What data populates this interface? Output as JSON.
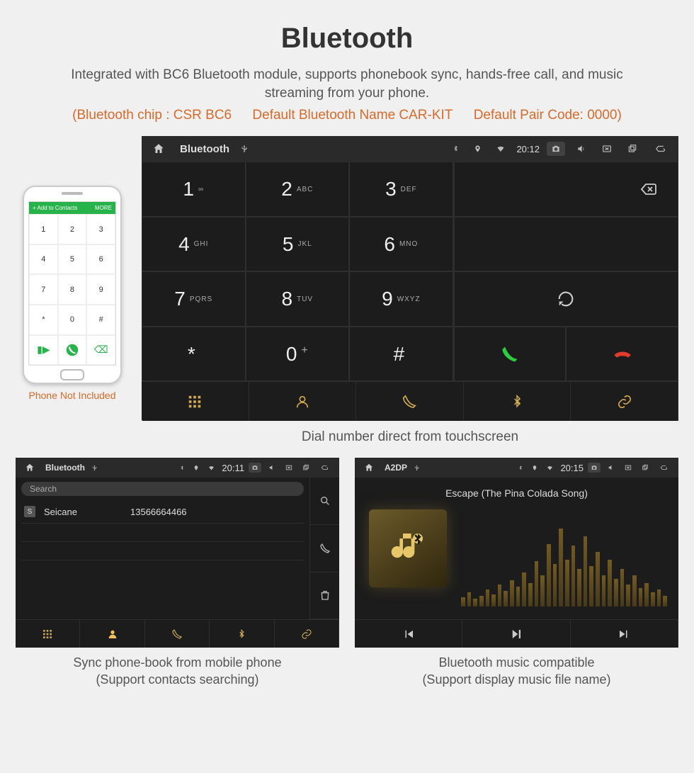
{
  "title": "Bluetooth",
  "subtitle": "Integrated with BC6 Bluetooth module, supports phonebook sync, hands-free call, and music streaming from your phone.",
  "spec": {
    "chip": "(Bluetooth chip : CSR BC6",
    "name": "Default Bluetooth Name CAR-KIT",
    "code": "Default Pair Code: 0000)"
  },
  "phone": {
    "bar_left": "+  Add to Contacts",
    "bar_right": "MORE",
    "caption": "Phone Not Included",
    "keys": [
      "1",
      "2",
      "3",
      "4",
      "5",
      "6",
      "7",
      "8",
      "9",
      "*",
      "0",
      "#"
    ]
  },
  "dialer": {
    "statusbar": {
      "app": "Bluetooth",
      "time": "20:12"
    },
    "keys": [
      {
        "d": "1",
        "l": "∞"
      },
      {
        "d": "2",
        "l": "ABC"
      },
      {
        "d": "3",
        "l": "DEF"
      },
      {
        "d": "4",
        "l": "GHI"
      },
      {
        "d": "5",
        "l": "JKL"
      },
      {
        "d": "6",
        "l": "MNO"
      },
      {
        "d": "7",
        "l": "PQRS"
      },
      {
        "d": "8",
        "l": "TUV"
      },
      {
        "d": "9",
        "l": "WXYZ"
      },
      {
        "d": "*",
        "l": ""
      },
      {
        "d": "0",
        "l": "+"
      },
      {
        "d": "#",
        "l": ""
      }
    ],
    "caption": "Dial number direct from touchscreen"
  },
  "contacts": {
    "statusbar": {
      "app": "Bluetooth",
      "time": "20:11"
    },
    "search_placeholder": "Search",
    "items": [
      {
        "initial": "S",
        "name": "Seicane",
        "number": "13566664466"
      }
    ],
    "caption": "Sync phone-book from mobile phone",
    "caption2": "(Support contacts searching)"
  },
  "music": {
    "statusbar": {
      "app": "A2DP",
      "time": "20:15"
    },
    "track": "Escape (The Pina Colada Song)",
    "caption": "Bluetooth music compatible",
    "caption2": "(Support display music file name)"
  },
  "icons": {
    "home": "⌂",
    "usb": "⎙",
    "bt": "⎋",
    "pin": "⚲",
    "wifi": "▾",
    "camera": "◎",
    "volume": "🔈",
    "close": "⮿",
    "recents": "❐",
    "back": "↶"
  }
}
